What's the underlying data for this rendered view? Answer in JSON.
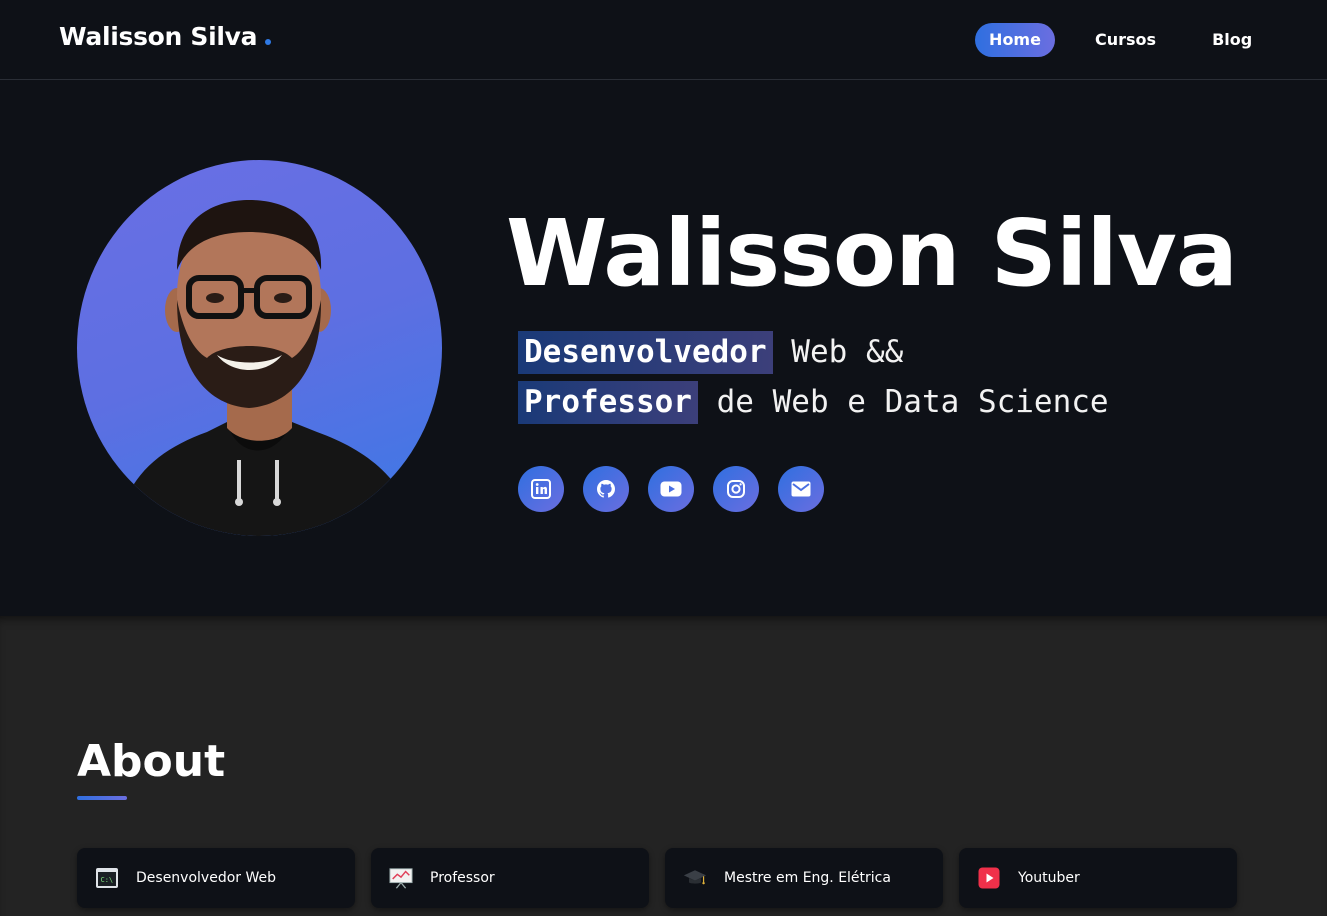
{
  "header": {
    "brand": "Walisson Silva",
    "nav": [
      {
        "label": "Home",
        "active": true
      },
      {
        "label": "Cursos",
        "active": false
      },
      {
        "label": "Blog",
        "active": false
      }
    ]
  },
  "hero": {
    "name": "Walisson Silva",
    "tagline_1": {
      "highlight": "Desenvolvedor",
      "rest": " Web &&"
    },
    "tagline_2": {
      "highlight": "Professor",
      "rest": " de Web e Data Science"
    },
    "socials": [
      "linkedin-icon",
      "github-icon",
      "youtube-icon",
      "instagram-icon",
      "mail-icon"
    ]
  },
  "about": {
    "title": "About",
    "cards": [
      {
        "label": "Desenvolvedor Web",
        "icon": "terminal-icon"
      },
      {
        "label": "Professor",
        "icon": "presentation-chart-icon"
      },
      {
        "label": "Mestre em Eng. Elétrica",
        "icon": "graduation-cap-icon"
      },
      {
        "label": "Youtuber",
        "icon": "youtube-play-icon"
      }
    ]
  },
  "colors": {
    "background": "#0e1117",
    "about_background": "#232323",
    "accent_start": "#2f6fe0",
    "accent_end": "#6b6ee0"
  }
}
